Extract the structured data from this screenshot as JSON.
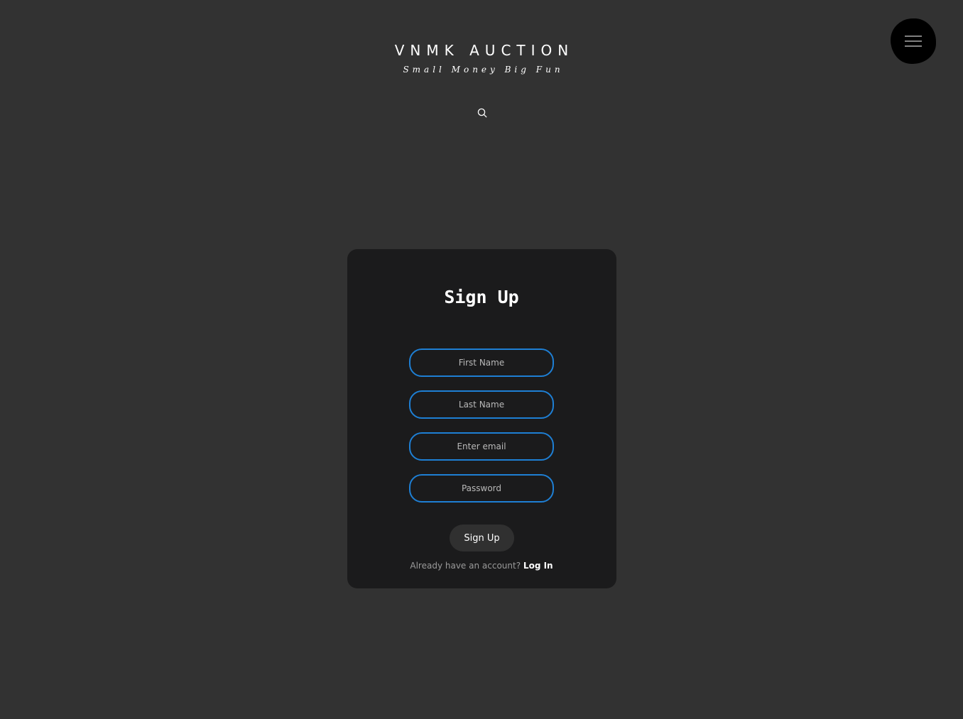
{
  "header": {
    "title": "VNMK AUCTION",
    "tagline": "Small Money Big Fun",
    "search_icon": "search-icon",
    "menu_icon": "hamburger-menu-icon"
  },
  "signup_form": {
    "title": "Sign Up",
    "fields": {
      "first_name_placeholder": "First Name",
      "last_name_placeholder": "Last Name",
      "email_placeholder": "Enter email",
      "password_placeholder": "Password"
    },
    "submit_label": "Sign Up",
    "login_prompt": "Already have an account?",
    "login_link": "Log In"
  },
  "colors": {
    "page_background": "#323232",
    "card_background": "#1b1b1c",
    "input_border": "#1e7fd4",
    "menu_button": "#000000"
  }
}
